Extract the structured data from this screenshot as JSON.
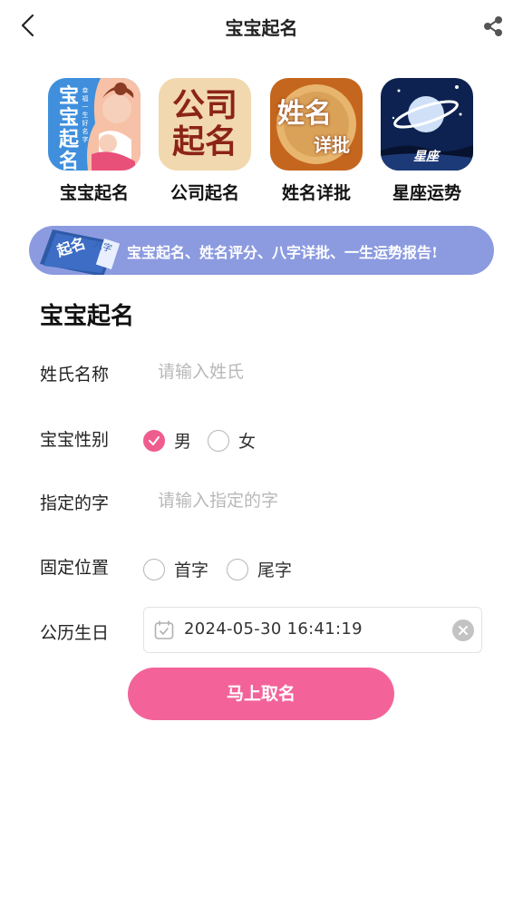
{
  "header": {
    "title": "宝宝起名",
    "back_icon": "chevron-left-icon",
    "share_icon": "share-icon"
  },
  "apps": [
    {
      "label": "宝宝起名",
      "tile_text": "宝宝起名",
      "tile_subtext": "幸福一生好名字"
    },
    {
      "label": "公司起名",
      "tile_text": "公司起名"
    },
    {
      "label": "姓名详批",
      "tile_text": "姓名",
      "tile_subtext": "详批"
    },
    {
      "label": "星座运势",
      "tile_text": "星座"
    }
  ],
  "banner": {
    "text": "宝宝起名、姓名评分、八字详批、一生运势报告!",
    "book_text": "起名",
    "book_tag": "八字"
  },
  "form": {
    "title": "宝宝起名",
    "surname": {
      "label": "姓氏名称",
      "placeholder": "请输入姓氏",
      "value": ""
    },
    "gender": {
      "label": "宝宝性别",
      "options": [
        "男",
        "女"
      ],
      "selected": "男"
    },
    "fixed_char": {
      "label": "指定的字",
      "placeholder": "请输入指定的字",
      "value": ""
    },
    "position": {
      "label": "固定位置",
      "options": [
        "首字",
        "尾字"
      ],
      "selected": ""
    },
    "birthday": {
      "label": "公历生日",
      "value": "2024-05-30 16:41:19"
    },
    "submit_label": "马上取名"
  },
  "colors": {
    "accent": "#f3639a",
    "radio_checked": "#ee5d8e",
    "banner": "#8c9be0"
  }
}
